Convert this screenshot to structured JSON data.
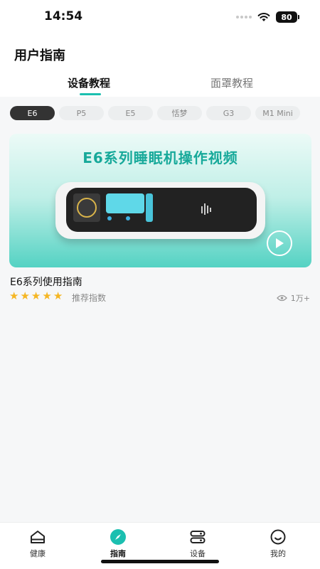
{
  "status": {
    "time": "14:54",
    "battery": "80"
  },
  "header": {
    "title": "用户指南"
  },
  "tabs": [
    {
      "label": "设备教程",
      "active": true
    },
    {
      "label": "面罩教程",
      "active": false
    }
  ],
  "chips": [
    "E6",
    "P5",
    "E5",
    "恬梦",
    "G3",
    "M1 Mini"
  ],
  "video": {
    "heading": "E6系列睡眠机操作视频"
  },
  "guide": {
    "title": "E6系列使用指南",
    "stars": 5,
    "rating_label": "推荐指数",
    "views": "1万+"
  },
  "nav": [
    {
      "label": "健康",
      "icon": "home-icon"
    },
    {
      "label": "指南",
      "icon": "compass-icon",
      "active": true
    },
    {
      "label": "设备",
      "icon": "device-icon"
    },
    {
      "label": "我的",
      "icon": "profile-icon"
    }
  ],
  "colors": {
    "accent": "#1bbfb0",
    "star": "#f5b623",
    "chip_active": "#333333"
  }
}
